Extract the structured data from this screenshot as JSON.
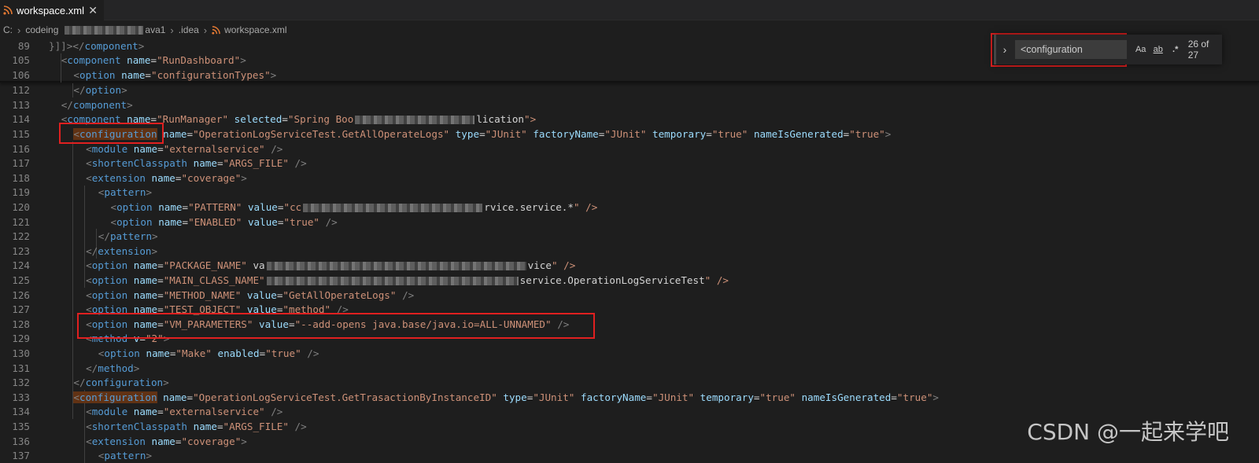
{
  "tab": {
    "filename": "workspace.xml",
    "icon": "rss-icon",
    "close": "✕"
  },
  "breadcrumb": {
    "drive": "C:",
    "folder1": "codeing",
    "folder2_suffix": "ava1",
    "folder3": ".idea",
    "file": "workspace.xml"
  },
  "find": {
    "query": "<configuration",
    "match_case": "Aa",
    "whole_word": "ab",
    "regex": ".*",
    "result": "26 of 27"
  },
  "lines": [
    {
      "n": "89",
      "code": "}]]></component>"
    },
    {
      "n": "105",
      "code": "<component name=\"RunDashboard\">"
    },
    {
      "n": "106",
      "code": "<option name=\"configurationTypes\">"
    },
    {
      "n": "112",
      "code": "</option>"
    },
    {
      "n": "113",
      "code": "</component>"
    },
    {
      "n": "114",
      "code": "<component name=\"RunManager\" selected=\"Spring Boo"
    },
    {
      "n": "115",
      "code": "<configuration name=\"OperationLogServiceTest.GetAllOperateLogs\" type=\"JUnit\" factoryName=\"JUnit\" temporary=\"true\" nameIsGenerated=\"true\">"
    },
    {
      "n": "116",
      "code": "<module name=\"externalservice\" />"
    },
    {
      "n": "117",
      "code": "<shortenClasspath name=\"ARGS_FILE\" />"
    },
    {
      "n": "118",
      "code": "<extension name=\"coverage\">"
    },
    {
      "n": "119",
      "code": "<pattern>"
    },
    {
      "n": "120",
      "code": "<option name=\"PATTERN\" value=\"cc"
    },
    {
      "n": "121",
      "code": "<option name=\"ENABLED\" value=\"true\" />"
    },
    {
      "n": "122",
      "code": "</pattern>"
    },
    {
      "n": "123",
      "code": "</extension>"
    },
    {
      "n": "124",
      "code": "<option name=\"PACKAGE_NAME\" va"
    },
    {
      "n": "125",
      "code": "<option name=\"MAIN_CLASS_NAME\""
    },
    {
      "n": "126",
      "code": "<option name=\"METHOD_NAME\" value=\"GetAllOperateLogs\" />"
    },
    {
      "n": "127",
      "code": "<option name=\"TEST_OBJECT\" value=\"method\" />"
    },
    {
      "n": "128",
      "code": "<option name=\"VM_PARAMETERS\" value=\"--add-opens java.base/java.io=ALL-UNNAMED\" />"
    },
    {
      "n": "129",
      "code": "<method v=\"2\">"
    },
    {
      "n": "130",
      "code": "<option name=\"Make\" enabled=\"true\" />"
    },
    {
      "n": "131",
      "code": "</method>"
    },
    {
      "n": "132",
      "code": "</configuration>"
    },
    {
      "n": "133",
      "code": "<configuration name=\"OperationLogServiceTest.GetTrasactionByInstanceID\" type=\"JUnit\" factoryName=\"JUnit\" temporary=\"true\" nameIsGenerated=\"true\">"
    },
    {
      "n": "134",
      "code": "<module name=\"externalservice\" />"
    },
    {
      "n": "135",
      "code": "<shortenClasspath name=\"ARGS_FILE\" />"
    },
    {
      "n": "136",
      "code": "<extension name=\"coverage\">"
    },
    {
      "n": "137",
      "code": "<pattern>"
    }
  ],
  "line_tails": {
    "114": "lication\">",
    "120": "rvice.service.*\" />",
    "124": "vice\" />",
    "125": "service.OperationLogServiceTest\" />"
  },
  "watermark": "CSDN @一起来学吧",
  "colors": {
    "tag": "#569cd6",
    "attribute": "#9cdcfe",
    "string": "#ce9178",
    "annotation": "#e02020",
    "match_highlight": "#613214"
  }
}
